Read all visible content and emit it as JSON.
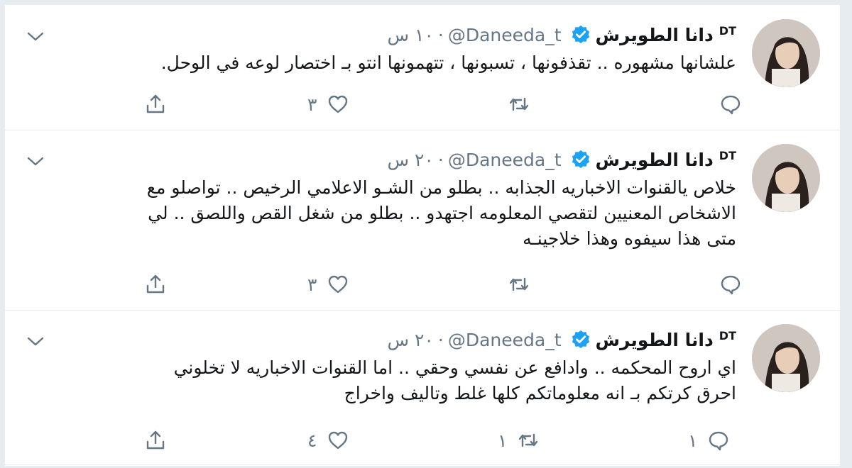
{
  "tweets": [
    {
      "name": "دانا الطويرش",
      "tag": "DT",
      "handle": "@Daneeda_t",
      "time": "١٠ س",
      "lines": [
        "علشانها مشهوره .. تقذفونها ، تسبونها ، تتهمونها انتو بـ اختصار لوعه في الوحل."
      ],
      "reply_count": "",
      "retweet_count": "",
      "like_count": "٣"
    },
    {
      "name": "دانا الطويرش",
      "tag": "DT",
      "handle": "@Daneeda_t",
      "time": "٢٠ س",
      "lines": [
        "خلاص يالقنوات الاخباريه الجذابه .. بطلو من الشـو الاعلامي الرخيص .. تواصلو مع",
        "الاشخاص المعنيين لتقصي المعلومه اجتهدو .. بطلو من شغل القص واللصق .. لي",
        "متى هذا سيفوه وهذا خلاجينـه"
      ],
      "reply_count": "",
      "retweet_count": "",
      "like_count": "٣"
    },
    {
      "name": "دانا الطويرش",
      "tag": "DT",
      "handle": "@Daneeda_t",
      "time": "٢٠ س",
      "lines": [
        "اي اروح المحكمه .. وادافع عن نفسي وحقي .. اما القنوات الاخباريه لا تخلوني",
        "احرق كرتكم بـ انه معلوماتكم كلها غلط وتاليف واخراج"
      ],
      "reply_count": "١",
      "retweet_count": "١",
      "like_count": "٤"
    }
  ],
  "icons": {
    "avatar": "profile-photo",
    "verified": "verified-badge-icon",
    "caret": "chevron-down-icon",
    "reply": "reply-bubble-icon",
    "retweet": "retweet-icon",
    "like": "heart-icon",
    "share": "share-upload-icon"
  },
  "colors": {
    "accent": "#1da1f2",
    "text": "#14171a",
    "muted": "#657786",
    "border": "#e6ecf0"
  }
}
